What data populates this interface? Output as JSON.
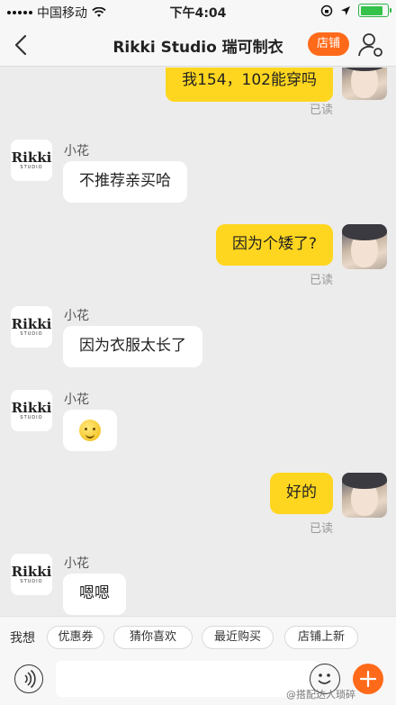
{
  "status_bar": {
    "carrier": "中国移动",
    "time": "下午4:04",
    "battery_color": "#35c24a",
    "battery_level": 0.85
  },
  "nav": {
    "title": "Rikki Studio 瑞可制衣",
    "shop_button": "店铺",
    "accent_color": "#ff6a1a"
  },
  "shop_avatar": {
    "logo_text": "Rikki",
    "logo_sub": "STUDIO"
  },
  "messages": [
    {
      "side": "right",
      "text": "我154，102能穿吗",
      "status": "已读"
    },
    {
      "side": "left",
      "sender": "小花",
      "text": "不推荐亲买哈"
    },
    {
      "side": "right",
      "text": "因为个矮了?",
      "status": "已读"
    },
    {
      "side": "left",
      "sender": "小花",
      "text": "因为衣服太长了"
    },
    {
      "side": "left",
      "sender": "小花",
      "emoji": "smile-emoji"
    },
    {
      "side": "right",
      "text": "好的",
      "status": "已读"
    },
    {
      "side": "left",
      "sender": "小花",
      "text": "嗯嗯"
    }
  ],
  "quick_replies": {
    "label": "我想",
    "items": [
      "优惠券",
      "猜你喜欢",
      "最近购买",
      "店铺上新"
    ]
  },
  "input": {
    "value": "",
    "placeholder": ""
  },
  "watermark": "@搭配达人琐碎"
}
